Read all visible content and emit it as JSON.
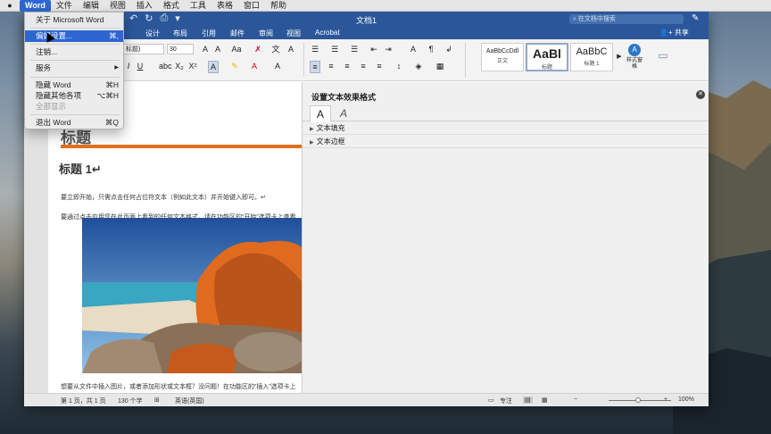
{
  "menubar": {
    "apple_icon": "",
    "items": [
      "Word",
      "文件",
      "编辑",
      "视图",
      "插入",
      "格式",
      "工具",
      "表格",
      "窗口",
      "帮助"
    ]
  },
  "app_menu": {
    "items": [
      {
        "label": "关于 Microsoft Word",
        "shortcut": ""
      },
      {
        "label": "偏好设置...",
        "shortcut": "⌘,"
      },
      {
        "label": "注销...",
        "shortcut": ""
      },
      {
        "label": "服务",
        "shortcut": "▶"
      },
      {
        "label": "隐藏 Word",
        "shortcut": "⌘H"
      },
      {
        "label": "隐藏其他各项",
        "shortcut": "⌥⌘H"
      },
      {
        "label": "全部显示",
        "shortcut": ""
      },
      {
        "label": "退出 Word",
        "shortcut": "⌘Q"
      }
    ]
  },
  "window": {
    "title": "文档1",
    "search_placeholder": "在文档中搜索",
    "share_label": "共享",
    "tabs": [
      "设计",
      "布局",
      "引用",
      "邮件",
      "审阅",
      "视图",
      "Acrobat"
    ]
  },
  "ribbon": {
    "style_value": "标题)",
    "font_size": "30",
    "styles": [
      {
        "sample": "AaBbCcDdl",
        "name": "正文"
      },
      {
        "sample": "AaBl",
        "name": "标题"
      },
      {
        "sample": "AaBbC",
        "name": "标题 1"
      }
    ],
    "styles_pane_label": "样式窗格"
  },
  "document": {
    "heading": "标题 1↵",
    "para1": "要立即开始，只需点击任何占位符文本（例如此文本）并开始键入即可。↵",
    "para2": "要通过点击应用您在此页面上看到的任何文本格式，请在功能区的“开始”选项卡上查看",
    "para3": "想要从文件中插入图片，或者添加形状或文本框？没问题！在功能区的“插入”选项卡上"
  },
  "pane": {
    "title": "设置文本效果格式",
    "tabs": [
      "A",
      "A"
    ],
    "sections": [
      "文本填充",
      "文本边框"
    ]
  },
  "statusbar": {
    "page": "第 1 页，共 1 页",
    "words": "130 个字",
    "language": "英语(英国)",
    "focus": "专注",
    "zoom": "100%"
  }
}
